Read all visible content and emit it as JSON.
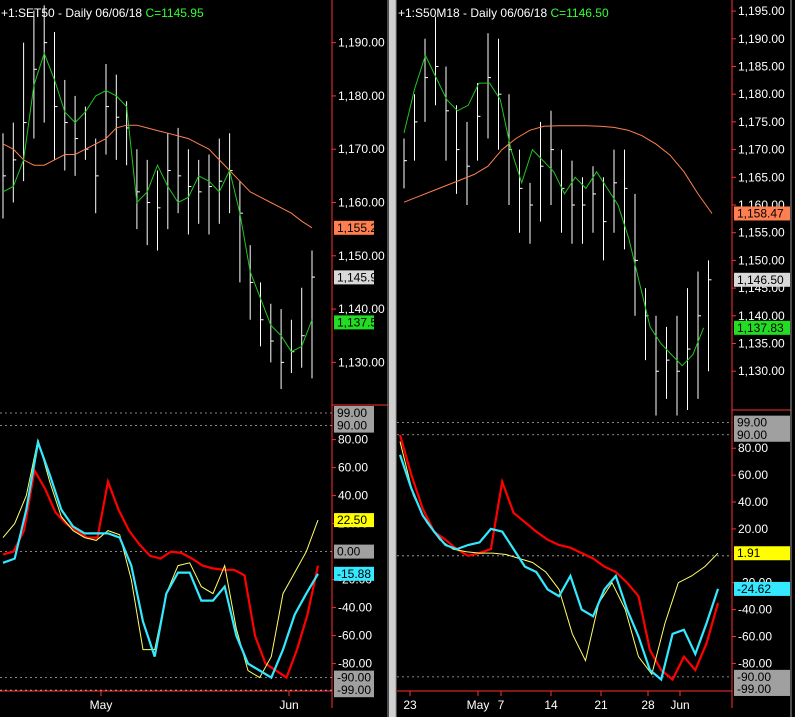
{
  "colors": {
    "background": "#000000",
    "bars": "#ffffff",
    "ma_fast": "#22c522",
    "ma_slow": "#ff7f50",
    "osc_red": "#ff0000",
    "osc_cyan": "#33e8ff",
    "osc_yellow": "#ffff66",
    "axis_line": "#ff3030",
    "badge_ma_slow": "#ff7f50",
    "badge_close": "#d9d9d9",
    "badge_ma_fast": "#22dd22",
    "badge_yellow": "#ffff00",
    "badge_cyan": "#33e8ff",
    "badge_gray": "#a0a0a0"
  },
  "panels": [
    {
      "header": {
        "symbol": "+1:SET50",
        "period": "Daily",
        "date": "06/06/18",
        "close_label": "C=1145.95"
      },
      "price_axis": {
        "range": [
          1122,
          1198
        ],
        "ticks": [
          1130,
          1140,
          1150,
          1160,
          1170,
          1180,
          1190
        ],
        "tick_labels": [
          "1,130.00",
          "1,140.00",
          "1,150.00",
          "1,160.00",
          "1,170.00",
          "1,180.00",
          "1,190.00"
        ]
      },
      "price_badges": [
        {
          "value": 1155.25,
          "text": "1,155.25",
          "kind": "ma_slow"
        },
        {
          "value": 1145.95,
          "text": "1,145.95",
          "kind": "close"
        },
        {
          "value": 1137.5,
          "text": "1,137.50",
          "kind": "ma_fast"
        }
      ],
      "osc_axis": {
        "range": [
          -101,
          94
        ],
        "ticks": [
          -80,
          -60,
          -40,
          -20,
          20,
          40,
          60,
          80
        ],
        "tick_labels": [
          "-80.00",
          "-60.00",
          "-40.00",
          "-20.00",
          "20.00",
          "40.00",
          "60.00",
          "80.00"
        ]
      },
      "osc_badges": [
        {
          "value": 99,
          "text": "99.00",
          "kind": "gray"
        },
        {
          "value": 90,
          "text": "90.00",
          "kind": "gray"
        },
        {
          "value": 22.5,
          "text": "22.50",
          "kind": "yellow"
        },
        {
          "value": 0,
          "text": "0.00",
          "kind": "gray"
        },
        {
          "value": -15.88,
          "text": "-15.88",
          "kind": "cyan"
        },
        {
          "value": -90,
          "text": "-90.00",
          "kind": "gray"
        },
        {
          "value": -99,
          "text": "-99.00",
          "kind": "gray"
        }
      ],
      "dotted_levels": [
        99,
        90,
        0,
        -90,
        -99
      ],
      "x_labels": [
        "May",
        "Jun"
      ]
    },
    {
      "header": {
        "symbol": "+1:S50M18",
        "period": "Daily",
        "date": "06/06/18",
        "close_label": "C=1146.50"
      },
      "price_axis": {
        "range": [
          1123,
          1197
        ],
        "ticks": [
          1130,
          1135,
          1140,
          1145,
          1150,
          1155,
          1160,
          1165,
          1170,
          1175,
          1180,
          1185,
          1190,
          1195
        ],
        "tick_labels": [
          "1,130.00",
          "1,135.00",
          "1,140.00",
          "1,145.00",
          "1,150.00",
          "1,155.00",
          "1,160.00",
          "1,165.00",
          "1,170.00",
          "1,175.00",
          "1,180.00",
          "1,185.00",
          "1,190.00",
          "1,195.00"
        ]
      },
      "price_badges": [
        {
          "value": 1158.47,
          "text": "1,158.47",
          "kind": "ma_slow"
        },
        {
          "value": 1146.5,
          "text": "1,146.50",
          "kind": "close"
        },
        {
          "value": 1137.83,
          "text": "1,137.83",
          "kind": "ma_fast"
        }
      ],
      "osc_axis": {
        "range": [
          -102,
          98
        ],
        "ticks": [
          -80,
          -60,
          -40,
          -20,
          20,
          40,
          60,
          80
        ],
        "tick_labels": [
          "-80.00",
          "-60.00",
          "-40.00",
          "-20.00",
          "20.00",
          "40.00",
          "60.00",
          "80.00"
        ]
      },
      "osc_badges": [
        {
          "value": 99,
          "text": "99.00",
          "kind": "gray"
        },
        {
          "value": 90,
          "text": "90.00",
          "kind": "gray"
        },
        {
          "value": 1.91,
          "text": "1.91",
          "kind": "yellow"
        },
        {
          "value": -24.62,
          "text": "-24.62",
          "kind": "cyan"
        },
        {
          "value": -90,
          "text": "-90.00",
          "kind": "gray"
        },
        {
          "value": -99,
          "text": "-99.00",
          "kind": "gray"
        }
      ],
      "dotted_levels": [
        99,
        90,
        0,
        -90
      ],
      "x_labels": [
        "23",
        "May",
        "7",
        "14",
        "21",
        "28",
        "Jun"
      ]
    }
  ],
  "chart_data": [
    {
      "type": "line",
      "title": "+1:SET50 Daily 06/06/18 C=1145.95",
      "price": {
        "ylim": [
          1122,
          1198
        ],
        "bars_high": [
          1173,
          1175,
          1190,
          1196,
          1197,
          1192,
          1183,
          1180,
          1178,
          1172,
          1186,
          1184,
          1179,
          1170,
          1168,
          1166,
          1173,
          1174,
          1170,
          1168,
          1169,
          1172,
          1173,
          1164,
          1152,
          1145,
          1141,
          1140,
          1138,
          1144,
          1151
        ],
        "bars_low": [
          1157,
          1160,
          1164,
          1172,
          1175,
          1168,
          1166,
          1165,
          1168,
          1158,
          1169,
          1168,
          1167,
          1155,
          1152,
          1151,
          1155,
          1158,
          1154,
          1156,
          1154,
          1156,
          1158,
          1145,
          1138,
          1133,
          1130,
          1125,
          1128,
          1129,
          1127
        ],
        "bars_close": [
          1165,
          1168,
          1175,
          1185,
          1190,
          1178,
          1175,
          1172,
          1170,
          1165,
          1178,
          1176,
          1174,
          1162,
          1160,
          1159,
          1166,
          1165,
          1163,
          1162,
          1163,
          1164,
          1166,
          1158,
          1145,
          1138,
          1134,
          1130,
          1132,
          1135,
          1146
        ],
        "ma_fast": [
          1162,
          1163,
          1168,
          1182,
          1188,
          1183,
          1177,
          1175,
          1177,
          1180,
          1181,
          1180,
          1178,
          1160,
          1162,
          1167,
          1163,
          1160,
          1161,
          1165,
          1164,
          1162,
          1166,
          1158,
          1147,
          1142,
          1137,
          1135,
          1132,
          1133,
          1138
        ],
        "ma_slow": [
          1171,
          1170,
          1168,
          1167,
          1167,
          1168,
          1169,
          1169,
          1170,
          1171,
          1172,
          1174,
          1174.5,
          1174.5,
          1174,
          1173.5,
          1173,
          1172.5,
          1172,
          1171,
          1170,
          1168,
          1166,
          1164,
          1162,
          1161,
          1160,
          1159,
          1158,
          1156.5,
          1155.25
        ]
      },
      "oscillator": {
        "ylim": [
          -101,
          94
        ],
        "red": [
          -2,
          0,
          15,
          58,
          45,
          28,
          20,
          15,
          10,
          10,
          50,
          30,
          15,
          5,
          -3,
          -5,
          0,
          -1,
          -5,
          -10,
          -12,
          -13,
          -13,
          -17,
          -60,
          -80,
          -85,
          -90,
          -70,
          -45,
          -10
        ],
        "cyan": [
          -8,
          -5,
          30,
          78,
          55,
          30,
          18,
          13,
          13,
          13,
          10,
          -10,
          -50,
          -75,
          -30,
          -15,
          -15,
          -35,
          -35,
          -25,
          -60,
          -80,
          -85,
          -90,
          -70,
          -45,
          -30,
          -15.88
        ],
        "yellow": [
          10,
          20,
          40,
          80,
          50,
          25,
          15,
          10,
          8,
          15,
          12,
          -20,
          -70,
          -70,
          -30,
          -10,
          -8,
          -25,
          -30,
          -10,
          -55,
          -85,
          -90,
          -75,
          -30,
          -15,
          0,
          22.5
        ]
      },
      "x_tick_labels": [
        "May",
        "Jun"
      ]
    },
    {
      "type": "line",
      "title": "+1:S50M18 Daily 06/06/18 C=1146.50",
      "price": {
        "ylim": [
          1123,
          1197
        ],
        "bars_high": [
          1172,
          1180,
          1190,
          1194,
          1185,
          1178,
          1175,
          1182,
          1191,
          1190,
          1180,
          1170,
          1164,
          1175,
          1177,
          1170,
          1168,
          1165,
          1167,
          1165,
          1170,
          1170,
          1162,
          1145,
          1140,
          1138,
          1140,
          1145,
          1148,
          1150
        ],
        "bars_low": [
          1163,
          1168,
          1175,
          1178,
          1168,
          1162,
          1160,
          1168,
          1172,
          1170,
          1160,
          1155,
          1153,
          1157,
          1160,
          1155,
          1153,
          1153,
          1155,
          1150,
          1155,
          1152,
          1140,
          1132,
          1122,
          1125,
          1122,
          1123,
          1125,
          1130
        ],
        "bars_close": [
          1168,
          1175,
          1183,
          1185,
          1177,
          1170,
          1167,
          1176,
          1183,
          1180,
          1170,
          1163,
          1160,
          1167,
          1170,
          1163,
          1160,
          1160,
          1162,
          1157,
          1164,
          1163,
          1150,
          1140,
          1130,
          1132,
          1130,
          1134,
          1140,
          1146.5
        ],
        "ma_fast": [
          1173,
          1181,
          1187,
          1183,
          1179,
          1177,
          1178,
          1182,
          1182,
          1179,
          1170,
          1164,
          1170,
          1168,
          1166,
          1162,
          1165,
          1163,
          1166,
          1163,
          1160,
          1154,
          1146,
          1138,
          1135,
          1133,
          1131,
          1133,
          1137.83
        ],
        "ma_slow": [
          1160.5,
          1161.5,
          1162.5,
          1163.5,
          1164.5,
          1165.5,
          1167,
          1170,
          1172,
          1173.5,
          1174.2,
          1174.3,
          1174.3,
          1174.3,
          1174.2,
          1174,
          1173.5,
          1172.5,
          1171,
          1169,
          1166,
          1162,
          1158.47
        ]
      },
      "oscillator": {
        "ylim": [
          -102,
          98
        ],
        "red": [
          90,
          60,
          35,
          18,
          12,
          5,
          0,
          2,
          5,
          55,
          32,
          25,
          18,
          12,
          8,
          6,
          2,
          -2,
          -8,
          -12,
          -20,
          -30,
          -70,
          -85,
          -92,
          -75,
          -85,
          -65,
          -35
        ],
        "cyan": [
          75,
          50,
          30,
          18,
          8,
          5,
          8,
          10,
          20,
          18,
          5,
          -8,
          -12,
          -25,
          -30,
          -15,
          -40,
          -45,
          -25,
          -15,
          -40,
          -60,
          -85,
          -92,
          -58,
          -55,
          -73,
          -50,
          -24.62
        ],
        "yellow": [
          85,
          45,
          25,
          12,
          5,
          3,
          2,
          2,
          1,
          -2,
          -5,
          -12,
          -25,
          -58,
          -78,
          -35,
          -20,
          -40,
          -75,
          -88,
          -50,
          -20,
          -15,
          -8,
          1.91
        ]
      },
      "x_tick_labels": [
        "23",
        "May",
        "7",
        "14",
        "21",
        "28",
        "Jun"
      ]
    }
  ]
}
